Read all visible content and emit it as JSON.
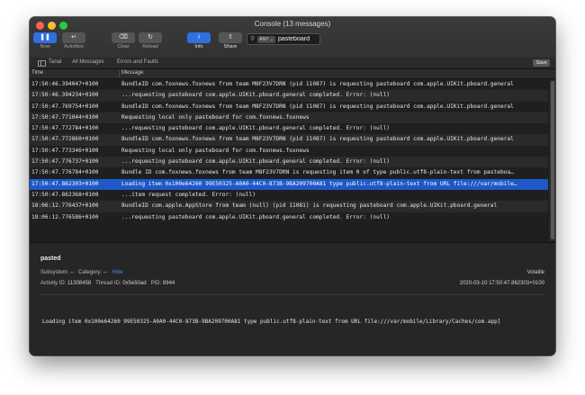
{
  "window": {
    "title": "Console (13 messages)"
  },
  "toolbar": {
    "now": "Now",
    "activities": "Activities",
    "clear": "Clear",
    "reload": "Reload",
    "info": "Info",
    "share": "Share"
  },
  "search": {
    "scope": "ANY",
    "value": "pasteboard"
  },
  "filters": {
    "tabs": [
      "Tanal",
      "All Messages",
      "Errors and Faults"
    ],
    "save": "Save"
  },
  "columns": {
    "time": "Time",
    "message": "Message"
  },
  "rows": [
    {
      "time": "17:50:46.394047+0100",
      "message": "BundleID com.foxnews.foxnews from team M8F23V7DRN (pid 11087) is requesting pasteboard com.apple.UIKit.pboard.general"
    },
    {
      "time": "17:50:46.394234+0100",
      "message": "...requesting pasteboard com.apple.UIKit.pboard.general completed. Error: (null)"
    },
    {
      "time": "17:50:47.769754+0100",
      "message": "BundleID com.foxnews.foxnews from team M8F23V7DRN (pid 11087) is requesting pasteboard com.apple.UIKit.pboard.general"
    },
    {
      "time": "17:50:47.771044+0100",
      "message": "Requesting local only pasteboard for com.foxnews.foxnews"
    },
    {
      "time": "17:50:47.772784+0100",
      "message": "...requesting pasteboard com.apple.UIKit.pboard.general completed. Error: (null)"
    },
    {
      "time": "17:50:47.772860+0100",
      "message": "BundleID com.foxnews.foxnews from team M8F23V7DRN (pid 11087) is requesting pasteboard com.apple.UIKit.pboard.general"
    },
    {
      "time": "17:50:47.773346+0100",
      "message": "Requesting local only pasteboard for com.foxnews.foxnews"
    },
    {
      "time": "17:50:47.776737+0100",
      "message": "...requesting pasteboard com.apple.UIKit.pboard.general completed. Error: (null)"
    },
    {
      "time": "17:50:47.776784+0100",
      "message": "Bundle ID com.foxnews.foxnews from team M8F23V7DRN is requesting item 0 of type public.utf8-plain-text from pasteboa…"
    },
    {
      "time": "17:50:47.862303+0100",
      "message": "Loading item 0x100e64260 99E50325-A0A0-44C0-873B-9BA209700A81 type public.utf8-plain-text from URL file:///var/mobile…"
    },
    {
      "time": "17:50:47.862368+0100",
      "message": "...item request completed. Error: (null)"
    },
    {
      "time": "18:06:12.776437+0100",
      "message": "BundleID com.apple.AppStore from team (null) (pid 11081) is requesting pasteboard com.apple.UIKit.pboard.general"
    },
    {
      "time": "18:06:12.776586+0100",
      "message": "...requesting pasteboard com.apple.UIKit.pboard.general completed. Error: (null)"
    }
  ],
  "selected_row": 9,
  "detail": {
    "title": "pasted",
    "subsystem_label": "Subsystem:",
    "subsystem_value": "--",
    "category_label": "Category:",
    "category_value": "--",
    "hide": "Hide",
    "activity_label": "Activity ID:",
    "activity_value": "11308458",
    "thread_label": "Thread ID:",
    "thread_value": "0x5e50ad",
    "pid_label": "PID:",
    "pid_value": "8944",
    "type": "Volatile",
    "timestamp": "2020-03-10 17:50:47.862303+0100",
    "message": "Loading item 0x100e64260 99E50325-A0A0-44C0-873B-9BA209700A81 type public.utf8-plain-text from URL file:///var/mobile/Library/Caches/com.app]"
  },
  "colors": {
    "accent": "#1e58c8",
    "info_button": "#2f6fe0",
    "link": "#4a8cf0"
  }
}
